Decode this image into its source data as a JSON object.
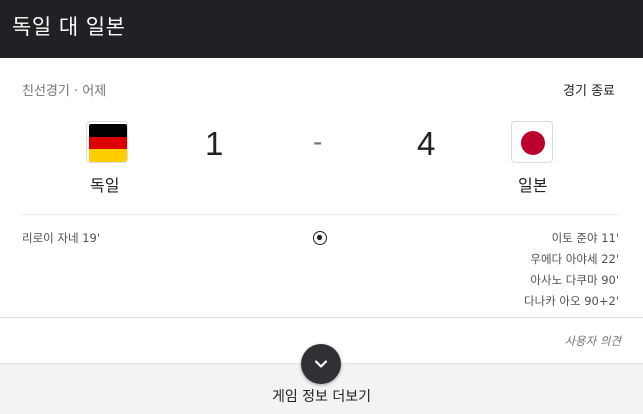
{
  "header": {
    "title": "독일 대 일본"
  },
  "match": {
    "competition_date": "친선경기 · 어제",
    "status": "경기 종료",
    "home": {
      "name": "독일",
      "score": "1",
      "flag_icon": "germany-flag-icon"
    },
    "away": {
      "name": "일본",
      "score": "4",
      "flag_icon": "japan-flag-icon"
    },
    "separator": "-",
    "home_scorers": [
      "리로이 자네 19'"
    ],
    "away_scorers": [
      "이토 준야 11'",
      "우에다 아야세 22'",
      "아사노 다쿠마 90'",
      "다나카 아오 90+2'"
    ],
    "goal_icon": "soccer-ball-icon"
  },
  "footer": {
    "feedback": "사용자 의견",
    "more_label": "게임 정보 더보기",
    "expand_icon": "chevron-down-icon"
  },
  "colors": {
    "header_bg": "#202124",
    "germany": [
      "#000000",
      "#dd0000",
      "#ffce00"
    ],
    "japan_red": "#bc002d",
    "footer_bg": "#f1f3f4"
  }
}
